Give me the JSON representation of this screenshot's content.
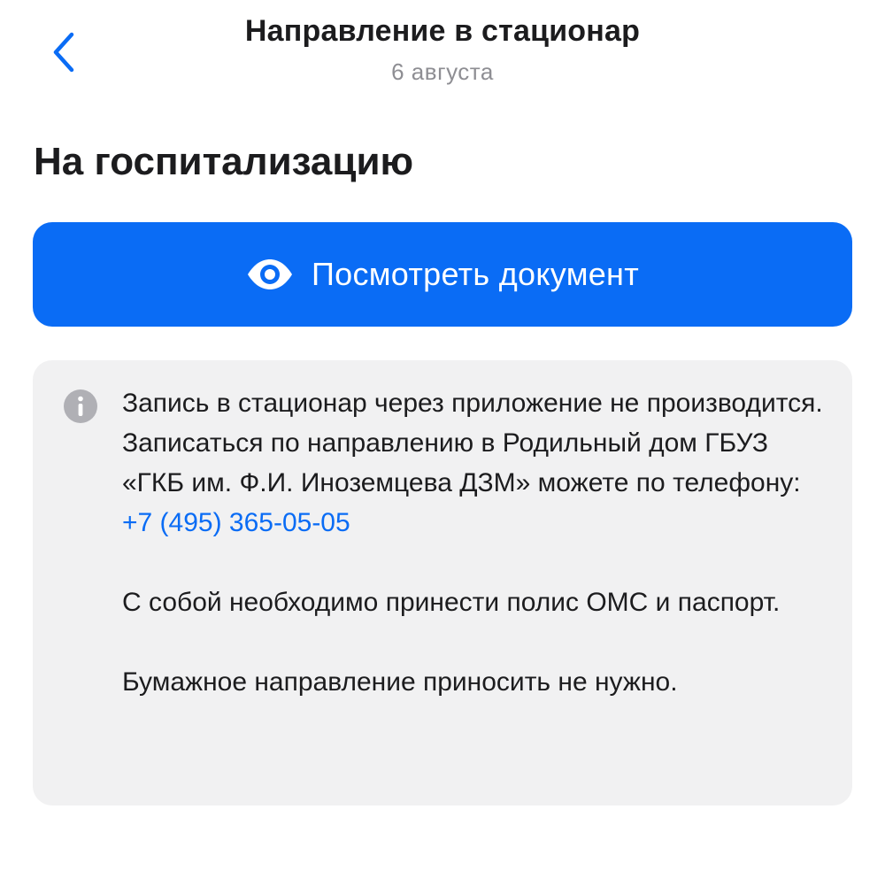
{
  "nav": {
    "title": "Направление в стационар",
    "subtitle": "6 августа",
    "back_icon": "chevron-left-icon"
  },
  "main": {
    "title": "На госпитализацию",
    "view_button": {
      "label": "Посмотреть документ",
      "icon": "eye-icon"
    },
    "info": {
      "icon": "info-icon",
      "paragraph1": "Запись в стационар через приложение не производится. Записаться по направлению в Родильный дом ГБУЗ «ГКБ им. Ф.И. Иноземцева ДЗМ» можете по телефону:",
      "phone": "+7 (495) 365-05-05",
      "paragraph2": "С собой необходимо принести полис ОМС и паспорт.",
      "paragraph3": "Бумажное направление приносить не нужно."
    }
  },
  "colors": {
    "accent": "#0a6cf5",
    "card_background": "#f1f1f2",
    "secondary_text": "#8e8e93",
    "info_icon": "#b0b0b5"
  }
}
